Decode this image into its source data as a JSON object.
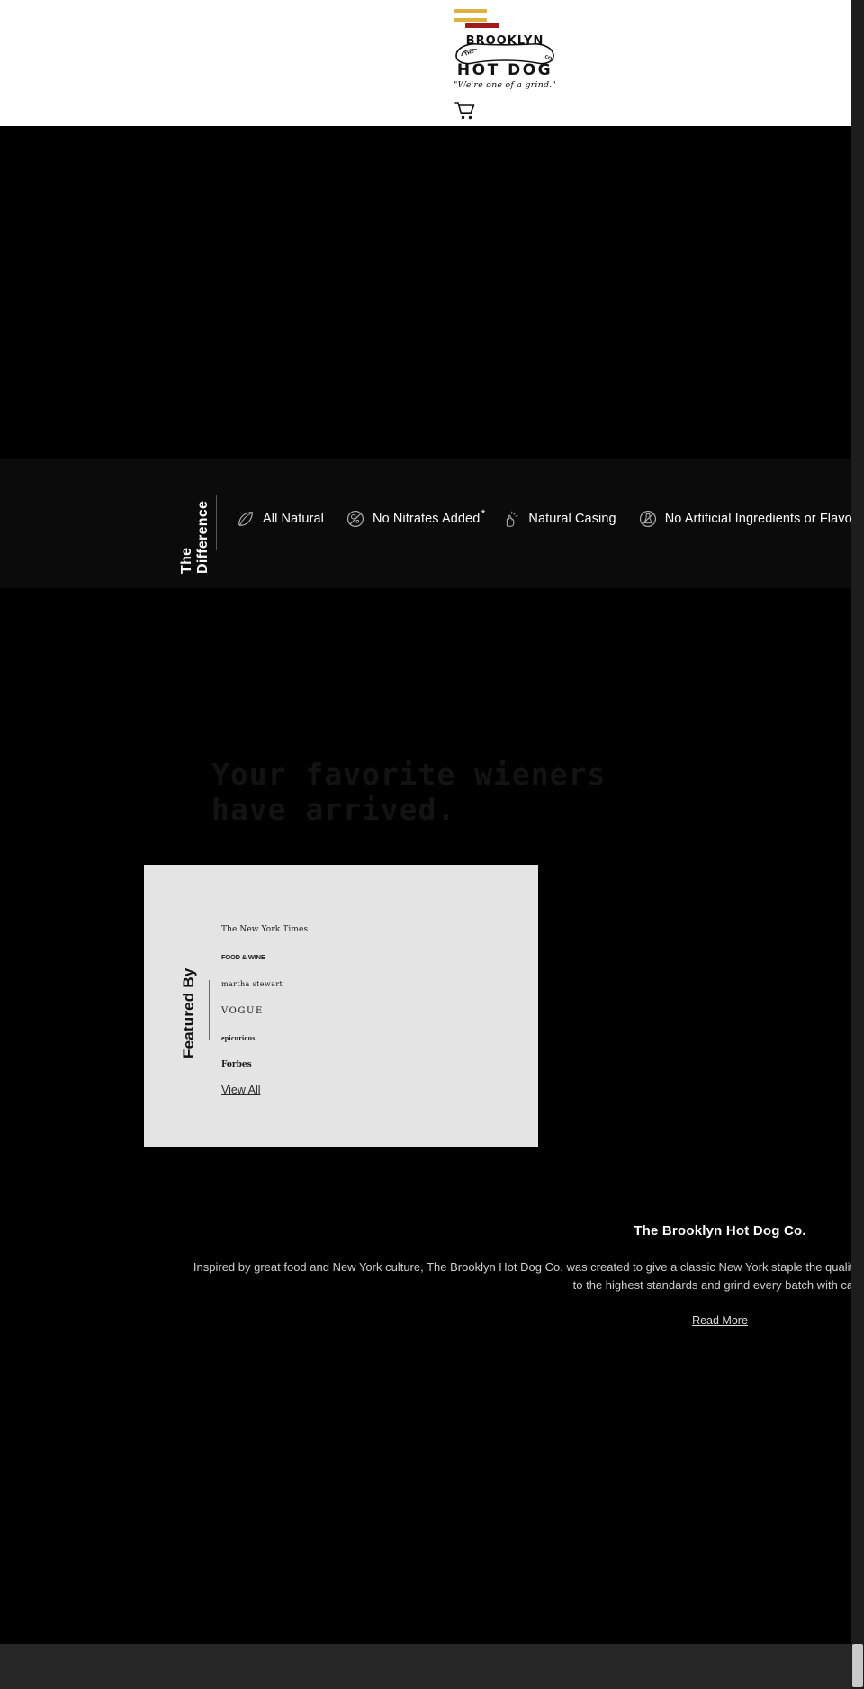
{
  "header": {
    "brand": {
      "the": "THE",
      "top_arc": "BROOKLYN",
      "co": "CO.",
      "main": "HOT DOG",
      "tagline": "\"We're one of a grind.\""
    },
    "cart_label": "cart-icon",
    "condiment_colors": {
      "mustard": "#e0b040",
      "ketchup": "#9e1b1b"
    }
  },
  "difference": {
    "section_label": "The Difference",
    "badges": [
      {
        "icon": "leaf-icon",
        "label": "All Natural",
        "asterisk": ""
      },
      {
        "icon": "no-nitrates-icon",
        "label": "No Nitrates Added",
        "asterisk": "*"
      },
      {
        "icon": "hand-pinch-icon",
        "label": "Natural Casing",
        "asterisk": ""
      },
      {
        "icon": "no-flask-icon",
        "label": "No Artificial Ingredients or Flavors",
        "asterisk": ""
      }
    ]
  },
  "hero": {
    "headline": "Your favorite wieners\nhave arrived."
  },
  "featured": {
    "section_label": "Featured By",
    "logos": [
      {
        "name": "the-new-york-times",
        "text": "The New York Times",
        "style": "nyt"
      },
      {
        "name": "food-and-wine",
        "text": "FOOD & WINE",
        "style": "fw"
      },
      {
        "name": "martha-stewart",
        "text": "martha stewart",
        "style": "ms"
      },
      {
        "name": "vogue",
        "text": "VOGUE",
        "style": "vogue"
      },
      {
        "name": "epicurious",
        "text": "epicurious",
        "style": "epi"
      },
      {
        "name": "forbes",
        "text": "Forbes",
        "style": "forbes"
      }
    ],
    "view_all_label": "View All"
  },
  "about": {
    "title": "The Brooklyn Hot Dog Co.",
    "body": "Inspired by great food and New York culture, The Brooklyn Hot Dog Co. was created to give a classic New York staple the quality and love it deserves. We source only the finest ingredients, hold ourselves to the highest standards and grind every batch with care.",
    "read_more_label": "Read More"
  },
  "colors": {
    "page_background": "#000000",
    "header_background": "#ffffff",
    "difference_background": "#0b0b0b",
    "featured_panel_background": "#e4e4e4",
    "footer_background": "#262626",
    "headline_text": "#131313"
  }
}
